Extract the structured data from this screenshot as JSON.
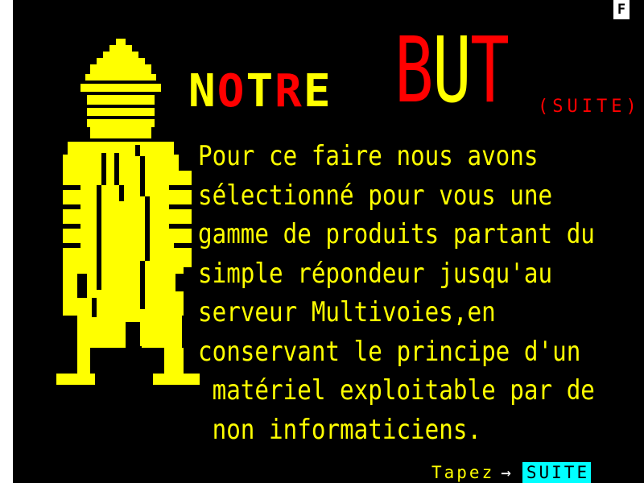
{
  "status_indicator": "F",
  "title": {
    "notre": [
      {
        "ch": "N",
        "color": "yellow"
      },
      {
        "ch": "O",
        "color": "red"
      },
      {
        "ch": "T",
        "color": "yellow"
      },
      {
        "ch": "R",
        "color": "red"
      },
      {
        "ch": "E",
        "color": "yellow"
      }
    ],
    "but": [
      {
        "ch": "B",
        "color": "red"
      },
      {
        "ch": "U",
        "color": "yellow"
      },
      {
        "ch": "T",
        "color": "red"
      }
    ],
    "suite_tag": "(SUITE)"
  },
  "body_lines": [
    "Pour ce faire nous avons",
    "sélectionné pour vous une",
    "gamme de produits partant du",
    "simple répondeur jusqu'au",
    "serveur Multivoies,en",
    "conservant le principe d'un",
    " matériel exploitable par de",
    " non informaticiens."
  ],
  "footer": {
    "prompt": "Tapez",
    "arrow": "→",
    "button_label": "SUITE"
  },
  "colors": {
    "background": "#000000",
    "yellow": "#ffff00",
    "red": "#ff0000",
    "cyan": "#00ffff",
    "white": "#ffffff"
  },
  "figure_icon": "yellow-robed-figure-illustration"
}
